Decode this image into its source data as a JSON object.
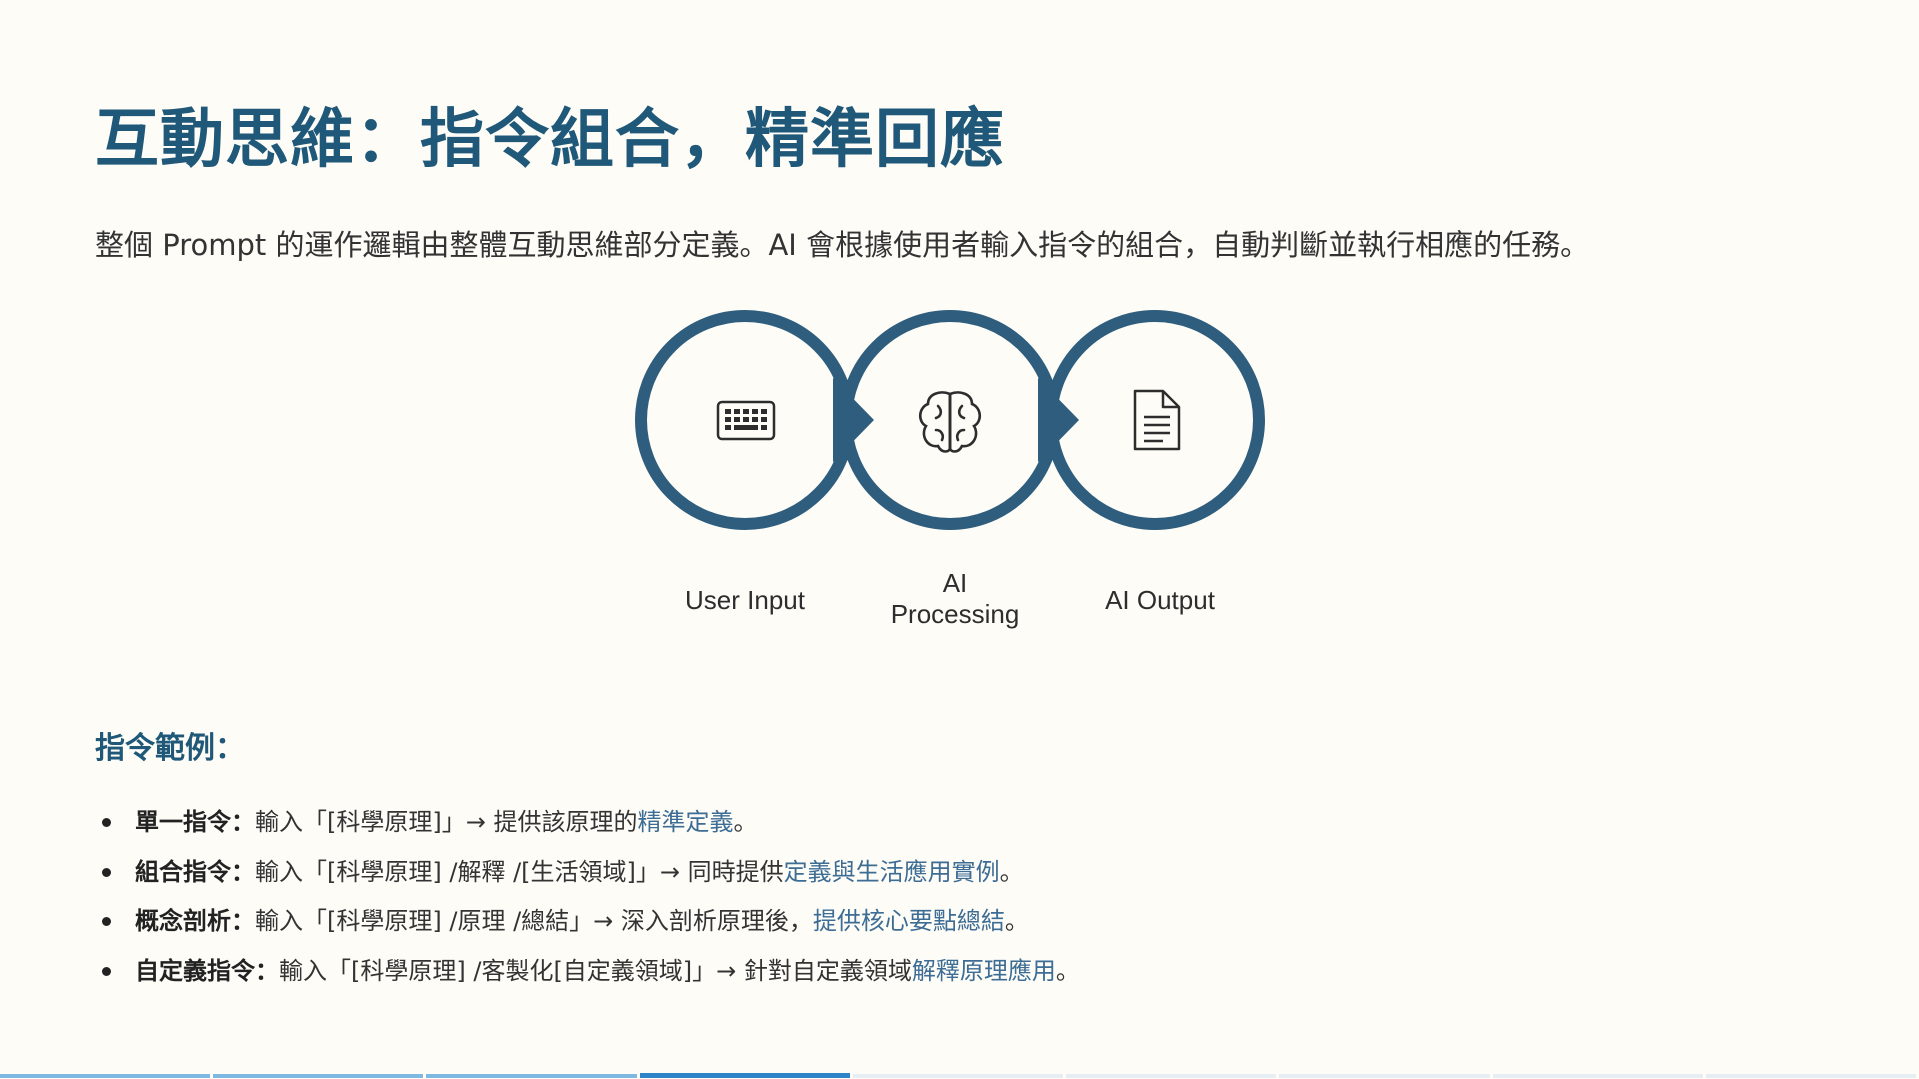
{
  "title": "互動思維：指令組合，精準回應",
  "subtitle": "整個 Prompt 的運作邏輯由整體互動思維部分定義。AI 會根據使用者輸入指令的組合，自動判斷並執行相應的任務。",
  "diagram": {
    "steps": [
      {
        "label": "User Input",
        "icon": "keyboard-icon"
      },
      {
        "label": "AI\nProcessing",
        "icon": "brain-icon"
      },
      {
        "label": "AI Output",
        "icon": "document-icon"
      }
    ],
    "ring_color": "#2e5d7d"
  },
  "examples": {
    "heading": "指令範例：",
    "items": [
      {
        "label": "單一指令：",
        "text": "輸入「[科學原理]」→ 提供該原理的",
        "highlight": "精準定義",
        "end": "。"
      },
      {
        "label": "組合指令：",
        "text": "輸入「[科學原理] /解釋 /[生活領域]」→ 同時提供",
        "highlight": "定義與生活應用實例",
        "end": "。"
      },
      {
        "label": "概念剖析：",
        "text": "輸入「[科學原理] /原理 /總結」→ 深入剖析原理後，",
        "highlight": "提供核心要點總結",
        "end": "。"
      },
      {
        "label": "自定義指令：",
        "text": "輸入「[科學原理] /客製化[自定義領域]」→ 針對自定義領域",
        "highlight": "解釋原理應用",
        "end": "。"
      }
    ]
  },
  "progress": {
    "total": 9,
    "current": 4
  },
  "colors": {
    "accent": "#1f5878",
    "highlight": "#3d6c94",
    "progress_done": "#7fb8e0",
    "progress_current": "#2f83c8"
  }
}
